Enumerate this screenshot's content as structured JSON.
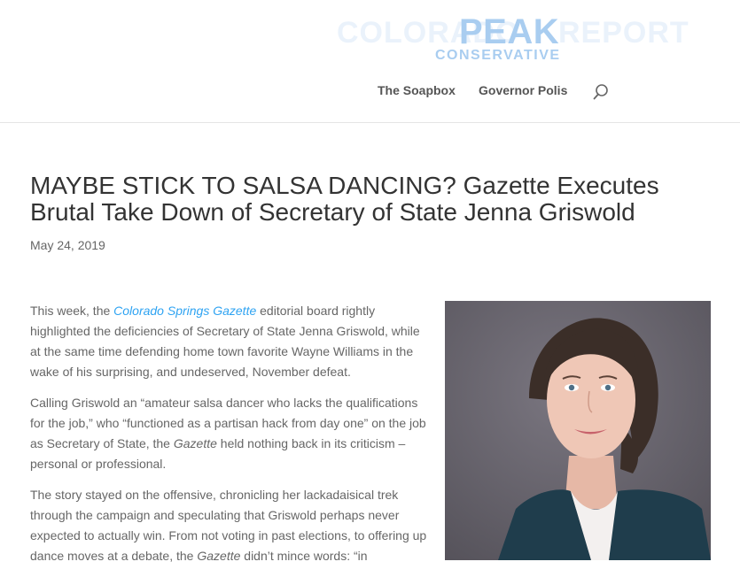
{
  "header": {
    "logo_main": "PEAK",
    "logo_sub": "CONSERVATIVE",
    "logo_ghost_left": "COLORADO",
    "logo_ghost_right": "REPORT",
    "nav": [
      {
        "label": "The Soapbox"
      },
      {
        "label": "Governor Polis"
      }
    ]
  },
  "article": {
    "title": "MAYBE STICK TO SALSA DANCING? Gazette Executes Brutal Take Down of Secretary of State Jenna Griswold",
    "date": "May 24, 2019",
    "p1_a": "This week, the ",
    "p1_link": "Colorado Springs Gazette",
    "p1_b": " editorial board rightly highlighted the deficiencies of Secretary of State Jenna Griswold, while at the same time defending home town favorite Wayne Williams in the wake of his surprising, and undeserved, November defeat.",
    "p2_a": "Calling Griswold an “amateur salsa dancer who lacks the qualifications for the job,” who “functioned as a partisan hack from day one” on the job as Secretary of State, the ",
    "p2_em": "Gazette",
    "p2_b": " held nothing back in its criticism – personal or professional.",
    "p3_a": "The story stayed on the offensive, chronicling her lackadaisical trek through the campaign and speculating that Griswold perhaps never expected to actually win.  From not voting in past elections, to offering up dance moves at a debate, the ",
    "p3_em": "Gazette",
    "p3_b": " didn’t mince words: “in"
  },
  "colors": {
    "logo": "#a9cdf0",
    "link": "#2ea3f2",
    "title": "#333333",
    "body_text": "#666666",
    "photo_bg": "#66626b",
    "jacket": "#1f3d4c"
  }
}
